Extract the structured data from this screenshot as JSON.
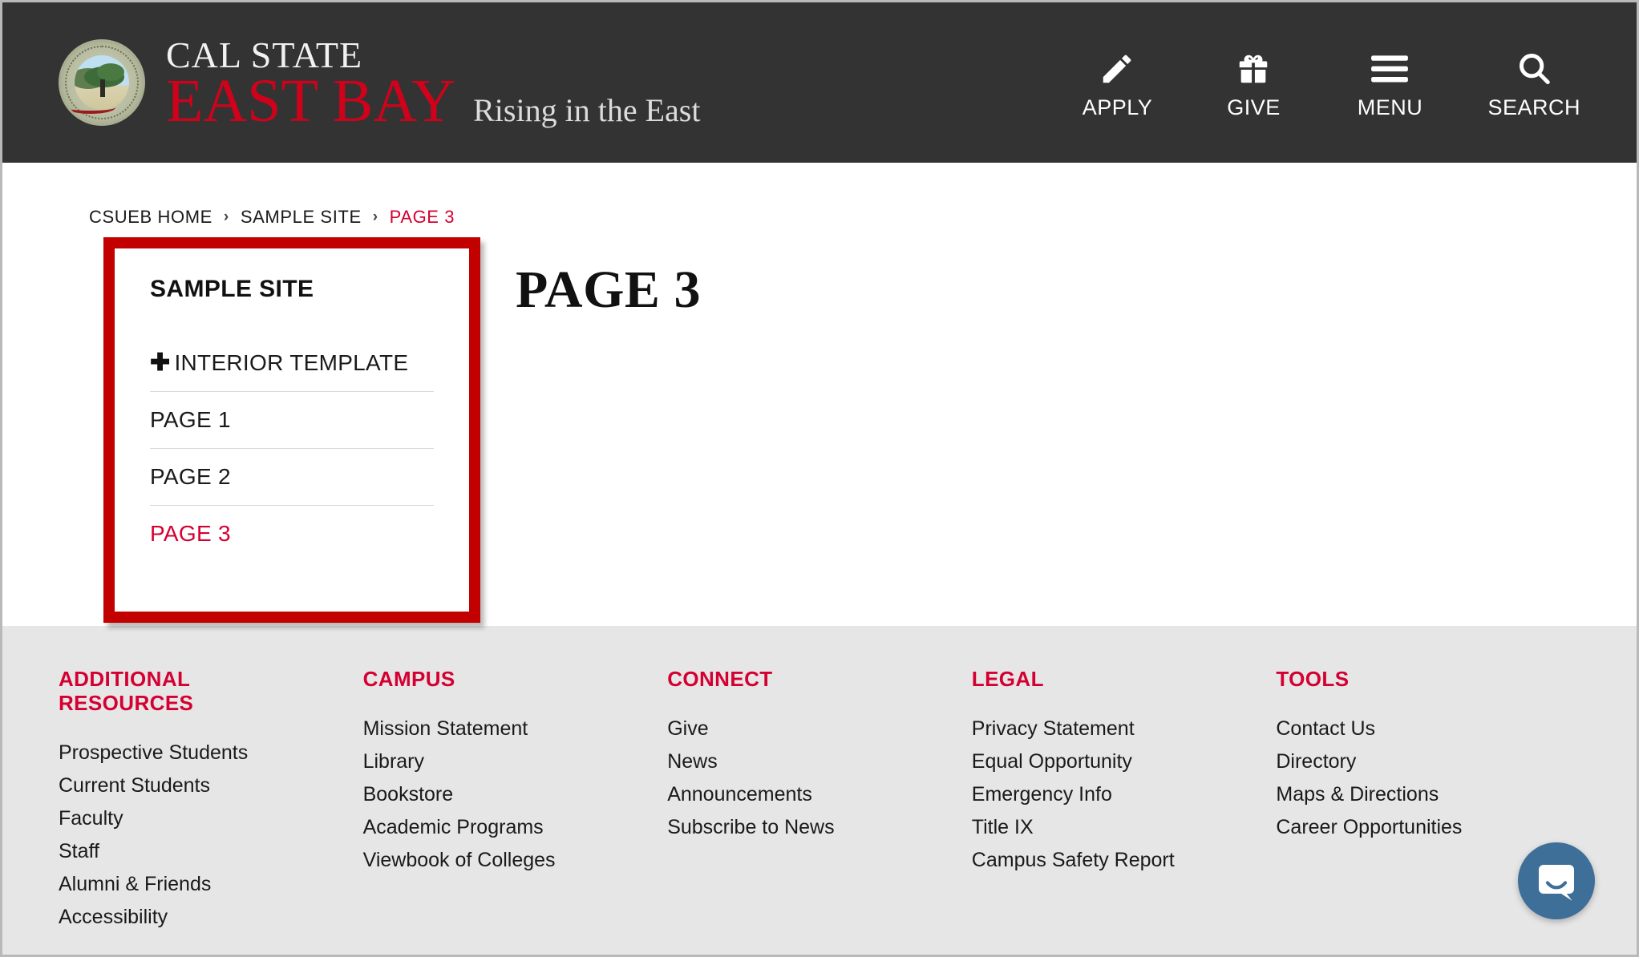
{
  "header": {
    "logo": {
      "seal_alt": "california-state-university-east-bay-seal",
      "line1": "CAL STATE",
      "line2": "EAST BAY",
      "tagline": "Rising in the East"
    },
    "nav": [
      {
        "label": "APPLY",
        "icon": "pencil-icon"
      },
      {
        "label": "GIVE",
        "icon": "gift-icon"
      },
      {
        "label": "MENU",
        "icon": "hamburger-icon"
      },
      {
        "label": "SEARCH",
        "icon": "search-icon"
      }
    ]
  },
  "breadcrumb": {
    "separator": "›",
    "items": [
      {
        "label": "CSUEB HOME",
        "active": false
      },
      {
        "label": "SAMPLE SITE",
        "active": false
      },
      {
        "label": "PAGE 3",
        "active": true
      }
    ]
  },
  "sidenav": {
    "title": "SAMPLE SITE",
    "expand_icon": "plus-icon",
    "items": [
      {
        "label": "INTERIOR TEMPLATE",
        "has_plus": true,
        "active": false
      },
      {
        "label": "PAGE 1",
        "has_plus": false,
        "active": false
      },
      {
        "label": "PAGE 2",
        "has_plus": false,
        "active": false
      },
      {
        "label": "PAGE 3",
        "has_plus": false,
        "active": true
      }
    ]
  },
  "main": {
    "page_title": "PAGE 3"
  },
  "footer": {
    "columns": [
      {
        "title": "ADDITIONAL RESOURCES",
        "links": [
          "Prospective Students",
          "Current Students",
          "Faculty",
          "Staff",
          "Alumni & Friends",
          "Accessibility"
        ]
      },
      {
        "title": "CAMPUS",
        "links": [
          "Mission Statement",
          "Library",
          "Bookstore",
          "Academic Programs",
          "Viewbook of Colleges"
        ]
      },
      {
        "title": "CONNECT",
        "links": [
          "Give",
          "News",
          "Announcements",
          "Subscribe to News"
        ]
      },
      {
        "title": "LEGAL",
        "links": [
          "Privacy Statement",
          "Equal Opportunity",
          "Emergency Info",
          "Title IX",
          "Campus Safety Report"
        ]
      },
      {
        "title": "TOOLS",
        "links": [
          "Contact Us",
          "Directory",
          "Maps & Directions",
          "Career Opportunities"
        ]
      }
    ]
  },
  "chat_widget": {
    "icon": "chat-bubble-icon"
  },
  "colors": {
    "header_bg": "#333333",
    "brand_red": "#d0021b",
    "accent_red": "#d50032",
    "annotation_red": "#c20000",
    "footer_bg": "#e6e6e6",
    "chat_blue": "#3e6f98"
  }
}
